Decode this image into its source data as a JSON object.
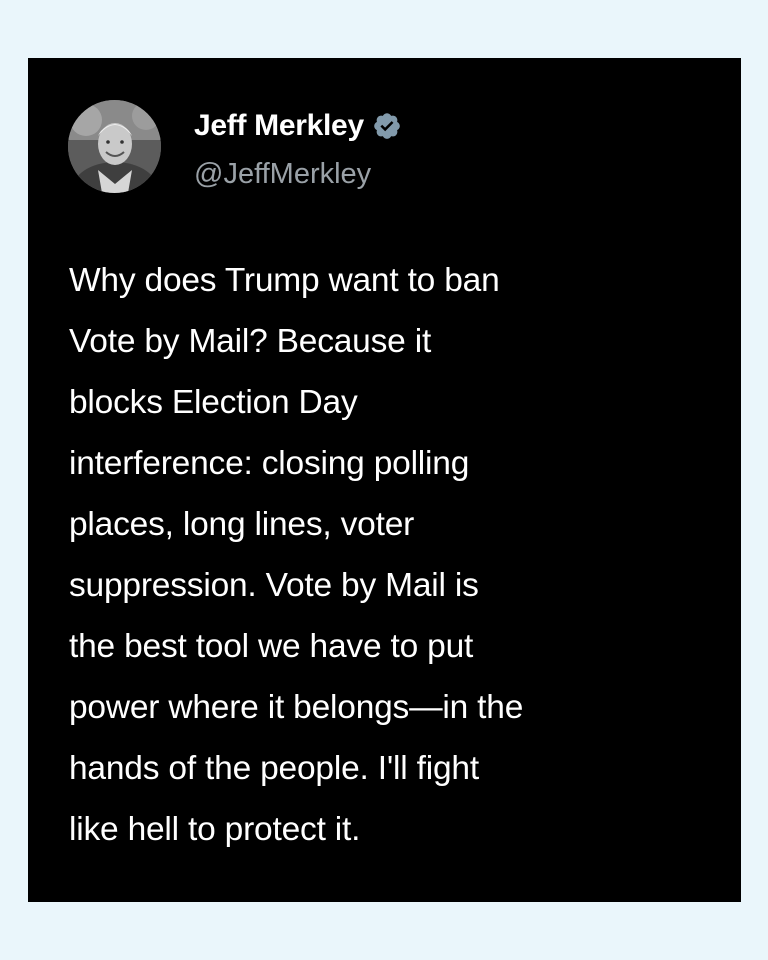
{
  "tweet": {
    "author": {
      "display_name": "Jeff Merkley",
      "handle": "@JeffMerkley",
      "verified": true,
      "avatar_icon": "profile-photo-avatar",
      "badge_icon": "verified-badge-icon",
      "badge_color": "#829aab"
    },
    "text_lines": [
      "Why does Trump want to ban",
      "Vote by Mail? Because it",
      "blocks Election Day",
      "interference: closing polling",
      "places, long lines, voter",
      "suppression. Vote by Mail is",
      "the best tool we have to put",
      "power where it belongs—in the",
      "hands of the people. I'll fight",
      "like hell to protect it."
    ]
  },
  "colors": {
    "page_background": "#eaf6fb",
    "card_background": "#000000",
    "name_text": "#ffffff",
    "handle_text": "#9aa1a7",
    "body_text": "#ffffff"
  }
}
